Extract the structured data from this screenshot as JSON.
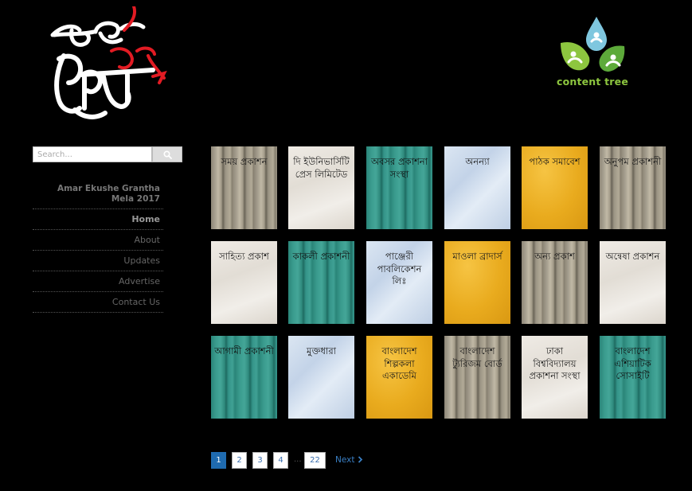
{
  "header": {
    "logo_text": "একুশে বই মেলা",
    "partner_logo": "content tree"
  },
  "search": {
    "placeholder": "Search..."
  },
  "sidebar": {
    "title": "Amar Ekushe Grantha Mela 2017",
    "items": [
      {
        "label": "Home",
        "active": true
      },
      {
        "label": "About",
        "active": false
      },
      {
        "label": "Updates",
        "active": false
      },
      {
        "label": "Advertise",
        "active": false
      },
      {
        "label": "Contact Us",
        "active": false
      }
    ]
  },
  "publishers": [
    {
      "name": "সময় প্রকাশন",
      "style": "wood"
    },
    {
      "name": "দি ইউনিভার্সিটি প্রেস লিমিটেড",
      "style": "crack"
    },
    {
      "name": "অবসর প্রকাশনা সংস্থা",
      "style": "teal"
    },
    {
      "name": "অনন্যা",
      "style": "ice"
    },
    {
      "name": "পাঠক সমাবেশ",
      "style": "yellow"
    },
    {
      "name": "অনুপম প্রকাশনী",
      "style": "wood"
    },
    {
      "name": "সাহিত্য প্রকাশ",
      "style": "crack"
    },
    {
      "name": "কাকলী প্রকাশনী",
      "style": "teal"
    },
    {
      "name": "পাঞ্জেরী পাবলিকেশন লিঃ",
      "style": "ice"
    },
    {
      "name": "মাওলা ব্রাদার্স",
      "style": "yellow"
    },
    {
      "name": "অন্য প্রকাশ",
      "style": "wood"
    },
    {
      "name": "অন্বেষা প্রকাশন",
      "style": "crack"
    },
    {
      "name": "আগামী প্রকাশনী",
      "style": "teal"
    },
    {
      "name": "মুক্তধারা",
      "style": "ice"
    },
    {
      "name": "বাংলাদেশ শিল্পকলা একাডেমি",
      "style": "yellow"
    },
    {
      "name": "বাংলাদেশ ট্যুরিজম বোর্ড",
      "style": "wood"
    },
    {
      "name": "ঢাকা বিশ্ববিদ্যালয় প্রকাশনা সংস্থা",
      "style": "crack"
    },
    {
      "name": "বাংলাদেশ এশিয়াটিক সোসাইটি",
      "style": "teal"
    }
  ],
  "pagination": {
    "pages": [
      "1",
      "2",
      "3",
      "4"
    ],
    "current": "1",
    "ellipsis": "...",
    "last": "22",
    "next_label": "Next"
  },
  "colors": {
    "background": "#000000",
    "accent_red": "#e21b23",
    "brand_green": "#8dc63f",
    "link_blue": "#3a7fc4"
  }
}
